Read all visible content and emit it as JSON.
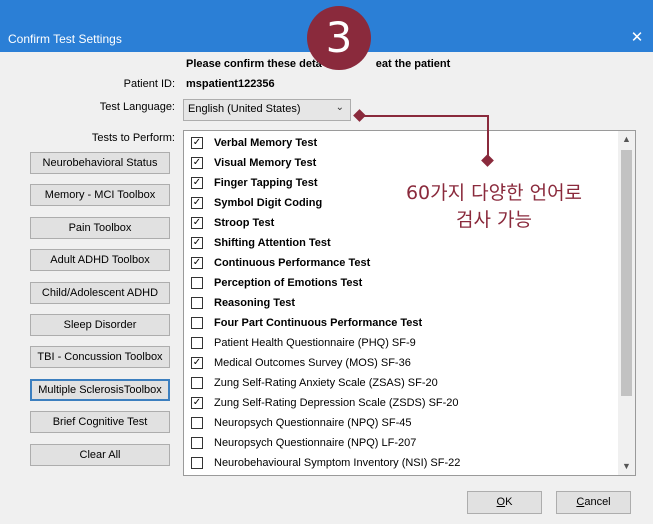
{
  "window": {
    "title": "Confirm Test Settings",
    "close_glyph": "✕"
  },
  "badge": {
    "number": "3"
  },
  "header": {
    "message": "Please confirm these deta",
    "message_tail": "eat the patient"
  },
  "patient": {
    "label": "Patient ID:",
    "value": "mspatient122356"
  },
  "language": {
    "label": "Test Language:",
    "value": "English (United States)",
    "chevron": "⌄"
  },
  "tests": {
    "label": "Tests to Perform:",
    "items": [
      {
        "label": "Verbal Memory Test",
        "checked": true,
        "bold": true
      },
      {
        "label": "Visual Memory Test",
        "checked": true,
        "bold": true
      },
      {
        "label": "Finger Tapping Test",
        "checked": true,
        "bold": true
      },
      {
        "label": "Symbol Digit Coding",
        "checked": true,
        "bold": true
      },
      {
        "label": "Stroop Test",
        "checked": true,
        "bold": true
      },
      {
        "label": "Shifting Attention Test",
        "checked": true,
        "bold": true
      },
      {
        "label": "Continuous Performance Test",
        "checked": true,
        "bold": true
      },
      {
        "label": "Perception of Emotions Test",
        "checked": false,
        "bold": true
      },
      {
        "label": "Reasoning Test",
        "checked": false,
        "bold": true
      },
      {
        "label": "Four Part Continuous Performance Test",
        "checked": false,
        "bold": true
      },
      {
        "label": "Patient Health Questionnaire (PHQ) SF-9",
        "checked": false,
        "bold": false
      },
      {
        "label": "Medical Outcomes Survey (MOS) SF-36",
        "checked": true,
        "bold": false
      },
      {
        "label": "Zung Self-Rating Anxiety Scale (ZSAS) SF-20",
        "checked": false,
        "bold": false
      },
      {
        "label": "Zung Self-Rating Depression Scale (ZSDS) SF-20",
        "checked": true,
        "bold": false
      },
      {
        "label": "Neuropsych Questionnaire (NPQ) SF-45",
        "checked": false,
        "bold": false
      },
      {
        "label": "Neuropsych Questionnaire (NPQ) LF-207",
        "checked": false,
        "bold": false
      },
      {
        "label": "Neurobehavioural Symptom Inventory (NSI) SF-22",
        "checked": false,
        "bold": false
      }
    ],
    "check_glyph": "✓"
  },
  "sidebar": {
    "buttons": [
      {
        "label": "Neurobehavioral Status",
        "active": false
      },
      {
        "label": "Memory - MCI Toolbox",
        "active": false
      },
      {
        "label": "Pain Toolbox",
        "active": false
      },
      {
        "label": "Adult ADHD Toolbox",
        "active": false
      },
      {
        "label": "Child/Adolescent ADHD",
        "active": false
      },
      {
        "label": "Sleep Disorder",
        "active": false
      },
      {
        "label": "TBI - Concussion Toolbox",
        "active": false
      },
      {
        "label": "Multiple SclerosisToolbox",
        "active": true
      },
      {
        "label": "Brief Cognitive Test",
        "active": false
      },
      {
        "label": "Clear All",
        "active": false
      }
    ]
  },
  "annotation": {
    "line1": "60가지 다양한 언어로",
    "line2": "검사 가능"
  },
  "footer": {
    "ok_mnemonic": "O",
    "ok_rest": "K",
    "cancel_mnemonic": "C",
    "cancel_rest": "ancel"
  },
  "colors": {
    "titlebar": "#2b7fd6",
    "accent": "#8a2a3c"
  },
  "scroll": {
    "up_glyph": "▲",
    "down_glyph": "▼"
  }
}
